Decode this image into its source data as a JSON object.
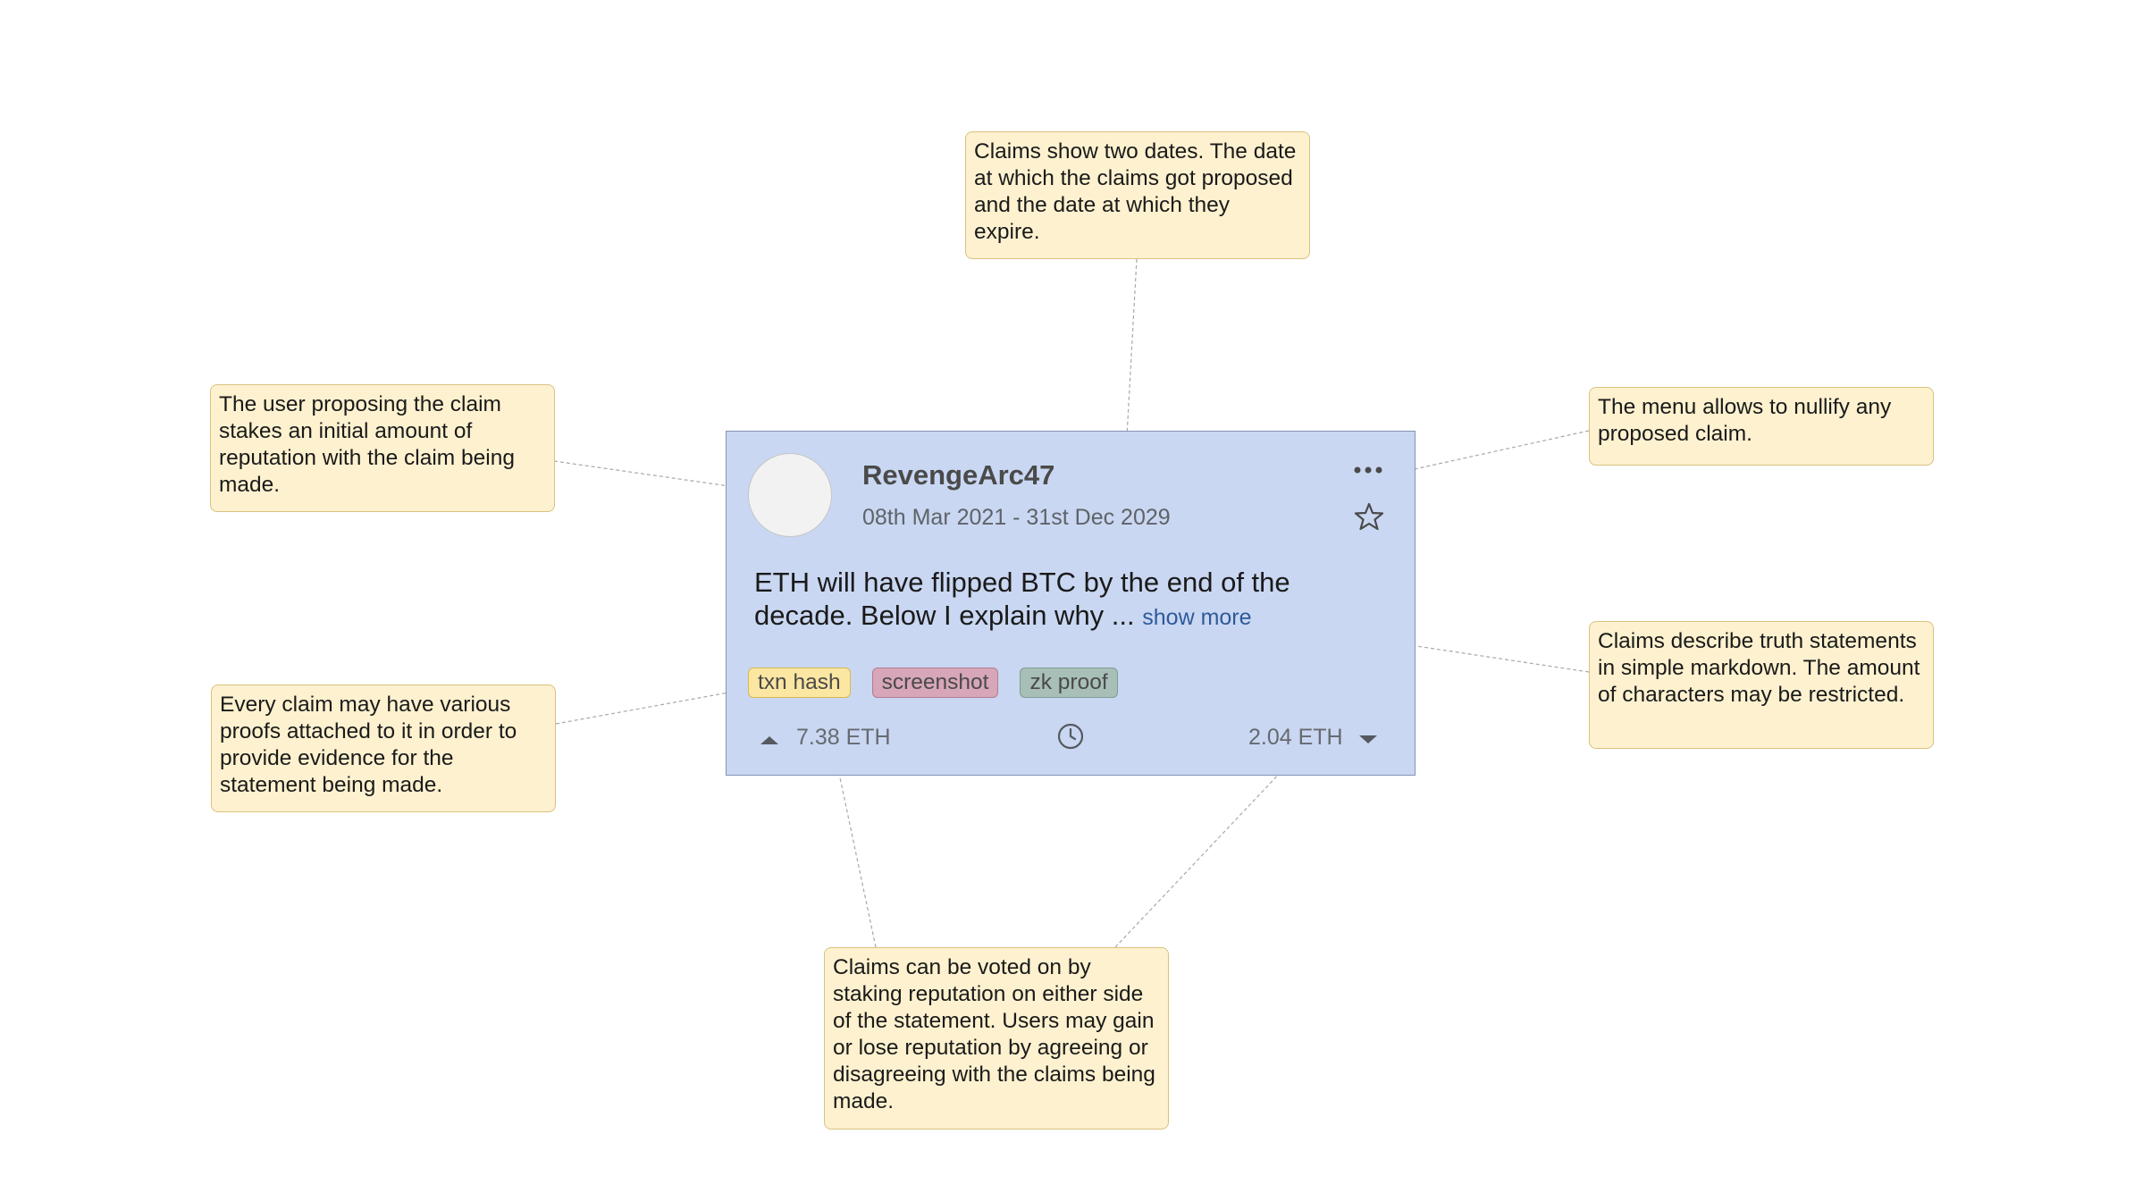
{
  "card": {
    "username": "RevengeArc47",
    "date_range": "08th Mar 2021 - 31st Dec 2029",
    "claim_text": "ETH will have flipped BTC by the end of the decade. Below I explain why ...",
    "show_more_label": "show more",
    "menu_icon": "more-horizontal-icon",
    "star_icon": "star-outline-icon",
    "tags": [
      {
        "label": "txn hash",
        "color": "#fbe6a2",
        "border": "#d8b84f"
      },
      {
        "label": "screenshot",
        "color": "#d7a6b8",
        "border": "#b37d92"
      },
      {
        "label": "zk proof",
        "color": "#a7bfb7",
        "border": "#7f9d94"
      }
    ],
    "votes": {
      "up_amount": "7.38 ETH",
      "down_amount": "2.04 ETH",
      "up_icon": "caret-up-icon",
      "down_icon": "caret-down-icon",
      "clock_icon": "clock-icon"
    },
    "background_color": "#c9d7f2"
  },
  "notes": {
    "dates": "Claims show two dates. The date at which the claims got proposed and the date at which they expire.",
    "user_stake": "The user proposing the claim stakes an initial amount of reputation with the claim being made.",
    "menu": "The menu allows to nullify any proposed claim.",
    "markdown": "Claims describe truth statements in simple markdown. The amount of characters may be restricted.",
    "proofs": "Every claim may have various proofs attached to it in order to provide evidence for the statement being made.",
    "voting": "Claims can be voted on by staking reputation on either side of the statement. Users may gain or lose reputation by agreeing or disagreeing with the claims being made."
  },
  "note_color": "#fdf1cf"
}
